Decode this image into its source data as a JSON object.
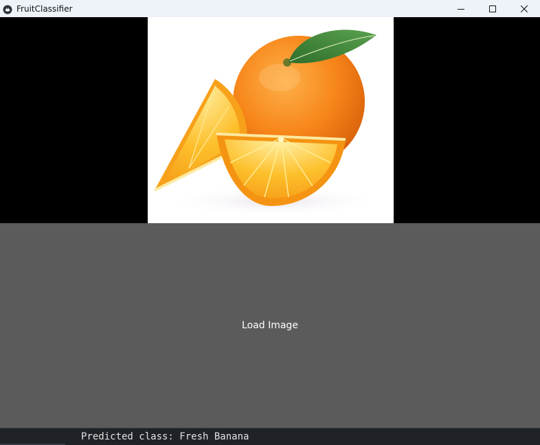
{
  "window": {
    "title": "FruitClassifier",
    "controls": {
      "minimize_icon": "minimize-icon",
      "maximize_icon": "maximize-icon",
      "close_icon": "close-icon"
    }
  },
  "image_panel": {
    "content": "orange-fruit-photo"
  },
  "load_button": {
    "label": "Load Image"
  },
  "status": {
    "prediction_text": "Predicted class: Fresh Banana"
  },
  "colors": {
    "titlebar": "#eef3f9",
    "image_background": "#000000",
    "button_background": "#5b5b5b",
    "button_text": "#ffffff",
    "status_background": "#1f2227",
    "status_text": "#e2e2e2",
    "orange_peel": "#f7861a",
    "orange_flesh": "#fbb21f",
    "leaf": "#3f8d3a"
  }
}
